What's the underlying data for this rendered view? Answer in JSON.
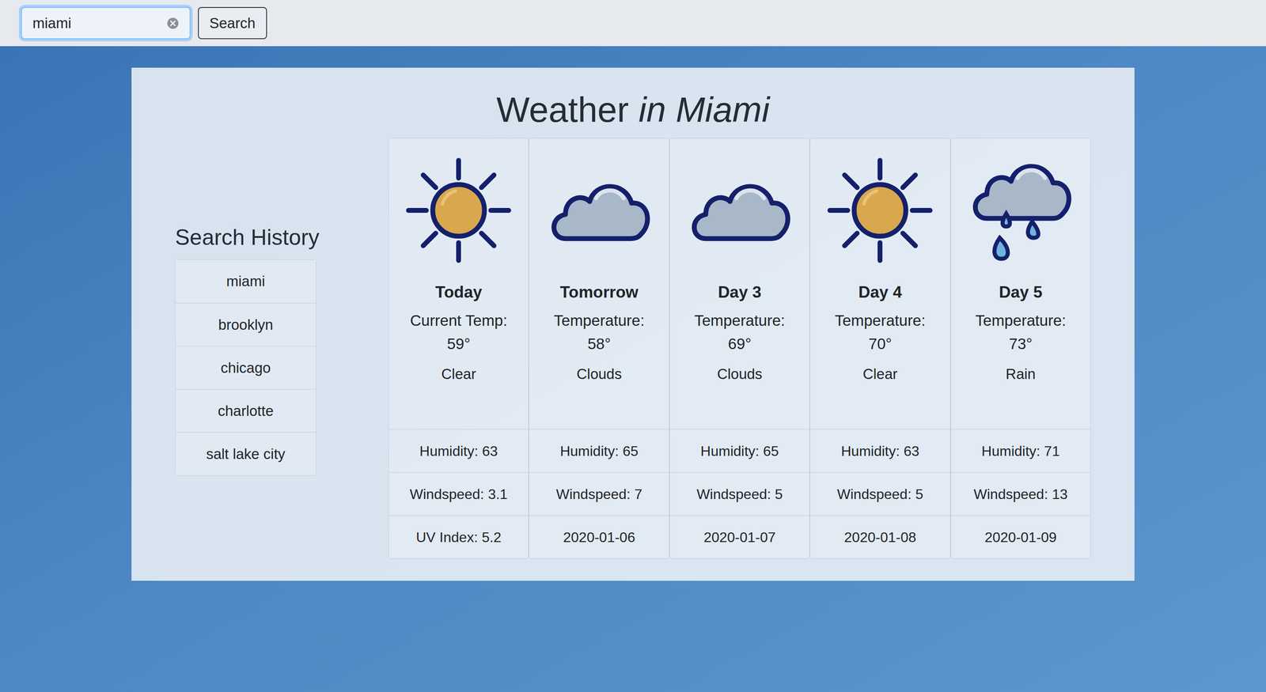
{
  "search": {
    "value": "miami",
    "button": "Search"
  },
  "title": {
    "main": "Weather",
    "emphasis": "in Miami"
  },
  "history": {
    "heading": "Search History",
    "items": [
      "miami",
      "brooklyn",
      "chicago",
      "charlotte",
      "salt lake city"
    ]
  },
  "forecast": [
    {
      "day": "Today",
      "temp_label": "Current Temp:",
      "temp": "59°",
      "condition": "Clear",
      "humidity": "Humidity: 63",
      "windspeed": "Windspeed: 3.1",
      "extra": "UV Index: 5.2"
    },
    {
      "day": "Tomorrow",
      "temp_label": "Temperature:",
      "temp": "58°",
      "condition": "Clouds",
      "humidity": "Humidity: 65",
      "windspeed": "Windspeed: 7",
      "extra": "2020-01-06"
    },
    {
      "day": "Day 3",
      "temp_label": "Temperature:",
      "temp": "69°",
      "condition": "Clouds",
      "humidity": "Humidity: 65",
      "windspeed": "Windspeed: 5",
      "extra": "2020-01-07"
    },
    {
      "day": "Day 4",
      "temp_label": "Temperature:",
      "temp": "70°",
      "condition": "Clear",
      "humidity": "Humidity: 63",
      "windspeed": "Windspeed: 5",
      "extra": "2020-01-08"
    },
    {
      "day": "Day 5",
      "temp_label": "Temperature:",
      "temp": "73°",
      "condition": "Rain",
      "humidity": "Humidity: 71",
      "windspeed": "Windspeed: 13",
      "extra": "2020-01-09"
    }
  ]
}
